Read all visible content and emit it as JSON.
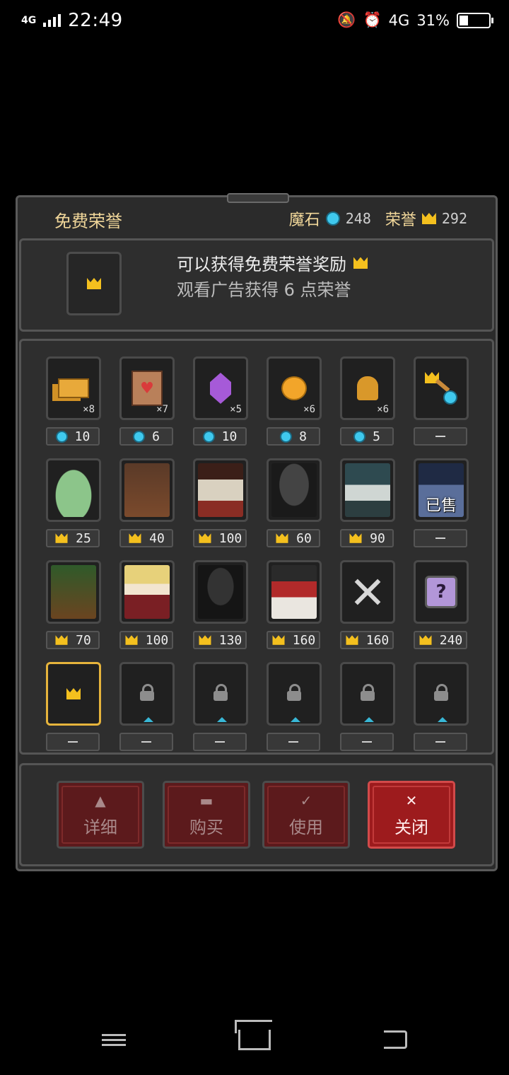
{
  "status_bar": {
    "network_left": "4G",
    "time": "22:49",
    "network_right": "4G",
    "battery_percent": "31%",
    "battery_level": 0.31,
    "icons": [
      "signal-icon",
      "mute-icon",
      "alarm-icon",
      "battery-icon"
    ]
  },
  "dialog": {
    "title": "免费荣誉",
    "currency": {
      "magic_stone_label": "魔石",
      "magic_stone_value": "248",
      "honor_label": "荣誉",
      "honor_value": "292"
    },
    "reward": {
      "line1": "可以获得免费荣誉奖励",
      "line2": "观看广告获得 6 点荣誉"
    },
    "items": [
      {
        "name": "gold-bars",
        "qty": "×8",
        "price": "10",
        "currency": "gem"
      },
      {
        "name": "heart-scroll",
        "qty": "×7",
        "price": "6",
        "currency": "gem"
      },
      {
        "name": "purple-crystal",
        "qty": "×5",
        "price": "10",
        "currency": "gem"
      },
      {
        "name": "golden-apple",
        "qty": "×6",
        "price": "8",
        "currency": "gem"
      },
      {
        "name": "golden-bell",
        "qty": "×6",
        "price": "5",
        "currency": "gem"
      },
      {
        "name": "honor-to-gem-exchange",
        "qty": "",
        "price": "—",
        "currency": "none"
      },
      {
        "name": "slime-hero",
        "qty": "",
        "price": "25",
        "currency": "crown"
      },
      {
        "name": "tree-hero",
        "qty": "",
        "price": "40",
        "currency": "crown"
      },
      {
        "name": "knight-hero",
        "qty": "",
        "price": "100",
        "currency": "crown"
      },
      {
        "name": "hooded-hero",
        "qty": "",
        "price": "60",
        "currency": "crown"
      },
      {
        "name": "maid-hero",
        "qty": "",
        "price": "90",
        "currency": "crown"
      },
      {
        "name": "elf-hero",
        "qty": "",
        "price": "—",
        "currency": "none",
        "sold": "已售"
      },
      {
        "name": "ent-hero",
        "qty": "",
        "price": "70",
        "currency": "crown"
      },
      {
        "name": "blonde-girl-hero",
        "qty": "",
        "price": "100",
        "currency": "crown"
      },
      {
        "name": "reaper-hero",
        "qty": "",
        "price": "130",
        "currency": "crown"
      },
      {
        "name": "witch-hero",
        "qty": "",
        "price": "160",
        "currency": "crown"
      },
      {
        "name": "crossed-swords",
        "qty": "",
        "price": "160",
        "currency": "crown"
      },
      {
        "name": "mystery-box",
        "qty": "",
        "price": "240",
        "currency": "crown"
      }
    ],
    "bottom_slots": [
      {
        "type": "crown",
        "selected": true,
        "price": "—"
      },
      {
        "type": "locked",
        "selected": false,
        "price": "—"
      },
      {
        "type": "locked",
        "selected": false,
        "price": "—"
      },
      {
        "type": "locked",
        "selected": false,
        "price": "—"
      },
      {
        "type": "locked",
        "selected": false,
        "price": "—"
      },
      {
        "type": "locked",
        "selected": false,
        "price": "—"
      }
    ],
    "buttons": {
      "detail": "详细",
      "buy": "购买",
      "use": "使用",
      "close": "关闭",
      "close_icon": "✕",
      "use_icon": "✓"
    },
    "question_mark": "?",
    "heart_glyph": "♥"
  },
  "colors": {
    "gold": "#f4c01e",
    "gem": "#3fc9ee",
    "close_button": "#9d1b1d",
    "selected_border": "#e6b43c"
  }
}
